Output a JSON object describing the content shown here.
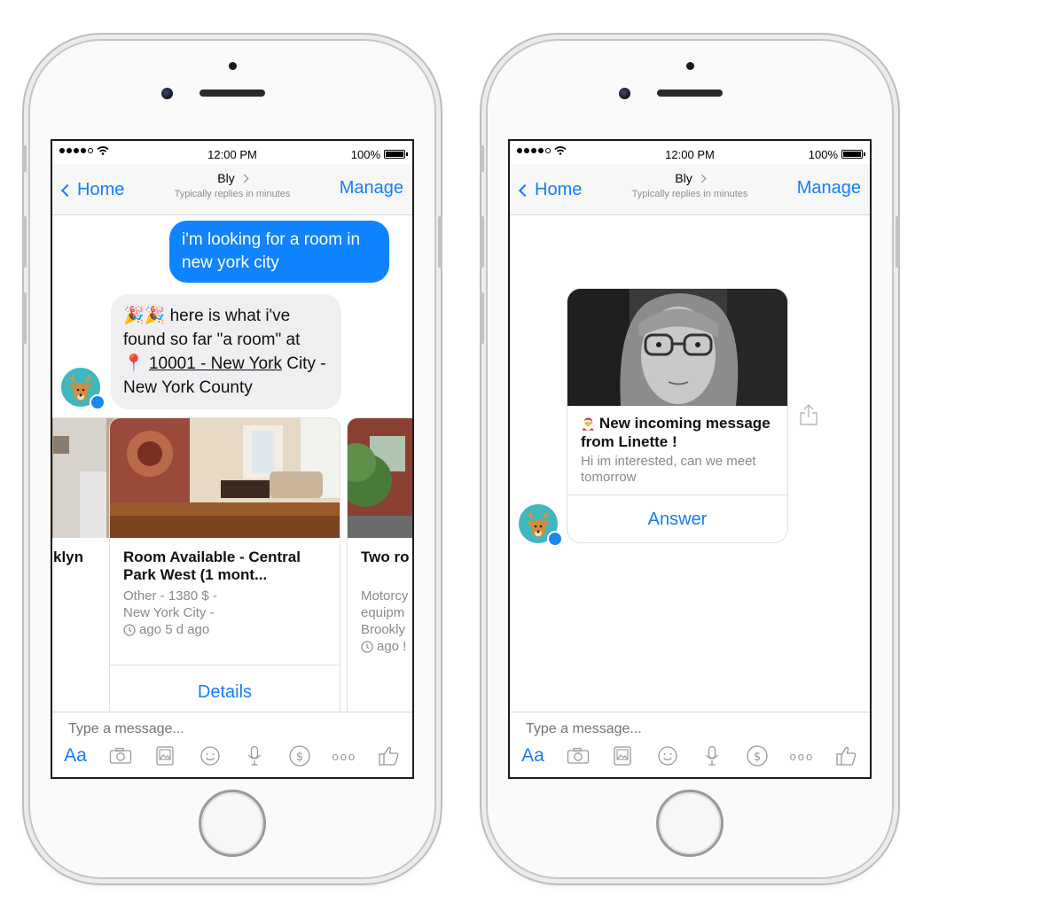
{
  "status_bar": {
    "time": "12:00 PM",
    "battery": "100%"
  },
  "nav": {
    "back_label": "Home",
    "title": "Bly",
    "subtitle": "Typically replies in minutes",
    "manage_label": "Manage"
  },
  "composer": {
    "placeholder": "Type a message...",
    "aa_label": "Aa",
    "more_label": "ooo"
  },
  "left": {
    "outgoing": "i'm looking for a room in new york city",
    "incoming": {
      "emoji": "🎉🎉",
      "lead": " here is what i've found so far \"a room\" at",
      "pin": "📍",
      "link": "10001 - New York",
      "tail": " City - New York County"
    },
    "carousel": [
      {
        "title": "klyn"
      },
      {
        "title": "Room Available - Central Park West (1 mont...",
        "line1": "Other - 1380 $ -",
        "line2": "New York City -",
        "line3": "ago 5 d ago",
        "button": "Details"
      },
      {
        "title": "Two ro Hill wa",
        "line1": "Motorcy",
        "line2": "equipm",
        "line3": "Brookly",
        "line4": "ago !"
      }
    ]
  },
  "right": {
    "card": {
      "title": "New incoming message from Linette !",
      "message": "Hi im interested, can we meet tomorrow",
      "button": "Answer"
    }
  },
  "colors": {
    "accent": "#147efb",
    "outgoing_bubble": "#1083fe",
    "incoming_bubble": "#efeff2",
    "avatar": "#41b6bc"
  }
}
